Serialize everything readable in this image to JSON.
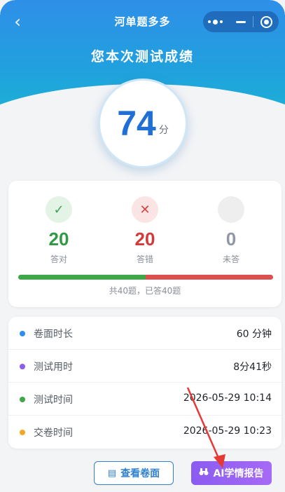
{
  "nav": {
    "back_icon": "chevron-left-icon",
    "title": "河单题多多",
    "capsule": {
      "more_icon": "more-dots-icon",
      "minimize_icon": "minimize-icon",
      "close_icon": "target-icon"
    }
  },
  "hero": {
    "headline": "您本次测试成绩"
  },
  "score": {
    "value": "74",
    "unit": "分"
  },
  "stats": {
    "correct": {
      "icon": "check-icon",
      "glyph": "✓",
      "value": "20",
      "label": "答对"
    },
    "wrong": {
      "icon": "cross-icon",
      "glyph": "✕",
      "value": "20",
      "label": "答错"
    },
    "unanswered": {
      "icon": "empty-circle-icon",
      "value": "0",
      "label": "未答"
    },
    "progress": {
      "correct_fraction": 0.5,
      "wrong_fraction": 0.5
    },
    "summary": "共40题，已答40题"
  },
  "info": [
    {
      "label": "卷面时长",
      "value": "60 分钟",
      "dot_color": "#2f8fe8"
    },
    {
      "label": "测试用时",
      "value": "8分41秒",
      "dot_color": "#8a5cf0"
    },
    {
      "label": "测试时间",
      "value": "2026-05-29 10:14",
      "dot_color": "#3fa64a"
    },
    {
      "label": "交卷时间",
      "value": "2026-05-29 10:23",
      "dot_color": "#f5a623"
    }
  ],
  "actions": {
    "view_paper": {
      "icon": "document-icon",
      "label": "查看卷面"
    },
    "ai_report": {
      "icon": "binoculars-icon",
      "label": "AI学情报告"
    }
  },
  "colors": {
    "primary": "#2f8fe8",
    "correct": "#3fa64a",
    "wrong": "#dd5050",
    "ai": "#8a5cf0"
  }
}
